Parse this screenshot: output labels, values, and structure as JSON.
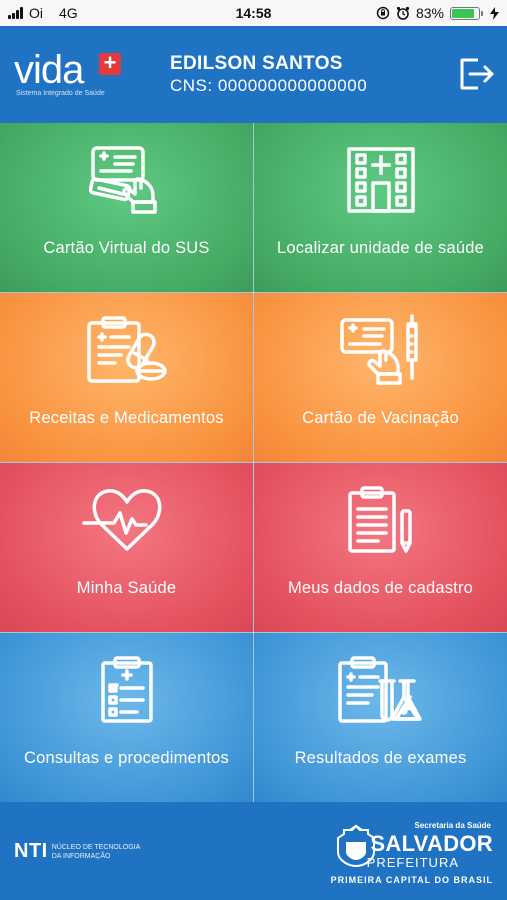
{
  "status_bar": {
    "carrier": "Oi",
    "network": "4G",
    "time": "14:58",
    "battery": "83%",
    "battery_level": 0.83,
    "icons": [
      "signal-icon",
      "rotation-lock-icon",
      "alarm-icon",
      "battery-icon",
      "charging-icon"
    ]
  },
  "header": {
    "logo_word": "vida",
    "logo_plus": "+",
    "logo_subtitle": "Sistema Integrado de Saúde",
    "user_name": "EDILSON SANTOS",
    "cns": "CNS: 000000000000000",
    "logout_icon": "logout-icon"
  },
  "menu": [
    {
      "label": "Cartão Virtual do SUS",
      "icon": "sus-card-icon",
      "color": "#45aa63"
    },
    {
      "label": "Localizar unidade de saúde",
      "icon": "hospital-icon",
      "color": "#45aa63"
    },
    {
      "label": "Receitas e Medicamentos",
      "icon": "prescription-icon",
      "color": "#f9923e"
    },
    {
      "label": "Cartão de Vacinação",
      "icon": "vaccine-card-icon",
      "color": "#f9923e"
    },
    {
      "label": "Minha Saúde",
      "icon": "heart-pulse-icon",
      "color": "#e4505d"
    },
    {
      "label": "Meus dados de cadastro",
      "icon": "clipboard-pen-icon",
      "color": "#e4505d"
    },
    {
      "label": "Consultas e procedimentos",
      "icon": "checklist-icon",
      "color": "#3f95d6"
    },
    {
      "label": "Resultados de exames",
      "icon": "lab-results-icon",
      "color": "#3f95d6"
    }
  ],
  "footer": {
    "nti": "NTI",
    "nti_line1": "NÚCLEO DE TECNOLOGIA",
    "nti_line2": "DA INFORMAÇÃO",
    "secretaria": "Secretaria da Saúde",
    "city": "SALVADOR",
    "prefeitura": "PREFEITURA",
    "slogan": "PRIMEIRA CAPITAL DO BRASIL"
  }
}
